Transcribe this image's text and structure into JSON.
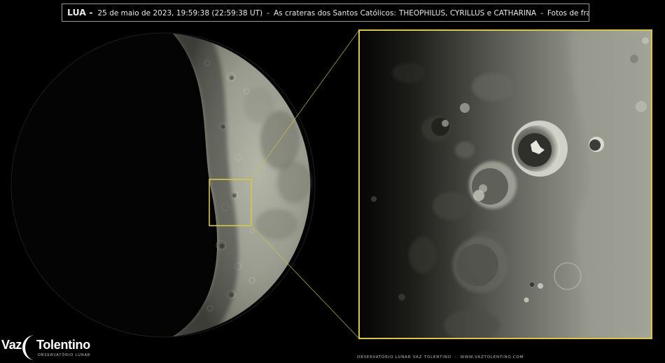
{
  "caption": {
    "title": "LUA -",
    "datetime": "25 de maio de 2023, 19:59:38 (22:59:38 UT)",
    "separator": "-",
    "description": "As crateras dos Santos Católicos:",
    "craters": "THEOPHILUS, CYRILLUS e CATHARINA",
    "note": "Fotos de frame único."
  },
  "logo": {
    "word1": "Vaz",
    "word2": "Tolentino",
    "subtitle": "OBSERVATÓRIO LUNAR"
  },
  "footer": {
    "observatory": "OBSERVATÓRIO LUNAR VAZ TOLENTINO",
    "dash": "-",
    "website": "WWW.VAZTOLENTINO.COM"
  },
  "colors": {
    "background": "#000000",
    "frame": "#d8c64b",
    "caption_border": "#9a9a9a"
  },
  "icons": {
    "logo_mark": "crescent-moon-icon"
  }
}
